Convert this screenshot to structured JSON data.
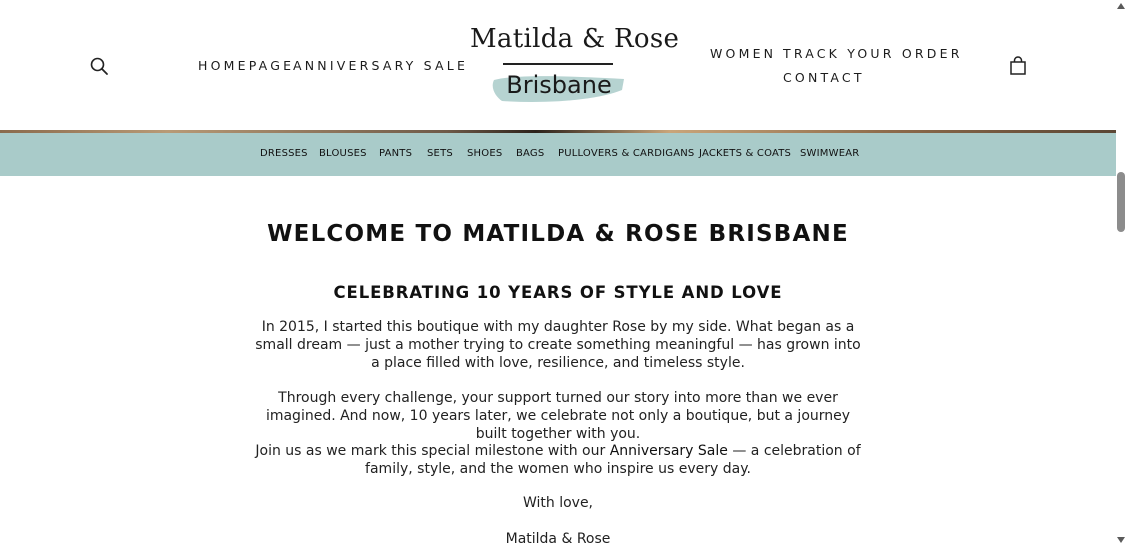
{
  "header": {
    "nav_left": [
      "HOMEPAGE",
      "ANNIVERSARY SALE"
    ],
    "nav_right": [
      "WOMEN",
      "TRACK YOUR ORDER",
      "CONTACT"
    ],
    "logo_title": "Matilda & Rose",
    "logo_sub": "Brisbane",
    "icons": {
      "search": "search-icon",
      "cart": "cart-icon"
    },
    "logo_swash_color": "#a9cbc9"
  },
  "categories": [
    "DRESSES",
    "BLOUSES",
    "PANTS",
    "SETS",
    "SHOES",
    "BAGS",
    "PULLOVERS & CARDIGANS",
    "JACKETS & COATS",
    "SWIMWEAR"
  ],
  "category_bar_color": "#a9cbc9",
  "main": {
    "title": "WELCOME TO MATILDA & ROSE BRISBANE",
    "subtitle": "CELEBRATING 10 YEARS OF STYLE AND LOVE",
    "para1": "In 2015, I started this boutique with my daughter Rose by my side. What began as a small dream — just a mother trying to create something meaningful — has grown into a place filled with love, resilience, and timeless style.",
    "para2": "Through every challenge, your support turned our story into more than we ever imagined. And now, 10 years later, we celebrate not only a boutique, but a journey built together with you.",
    "para3_before": "Join us as we mark this special milestone with our ",
    "para3_link": "Anniversary Sale",
    "para3_after": " — a celebration of family, style, and the women who inspire us every day.",
    "signoff": "With love,",
    "signature": "Matilda & Rose"
  }
}
